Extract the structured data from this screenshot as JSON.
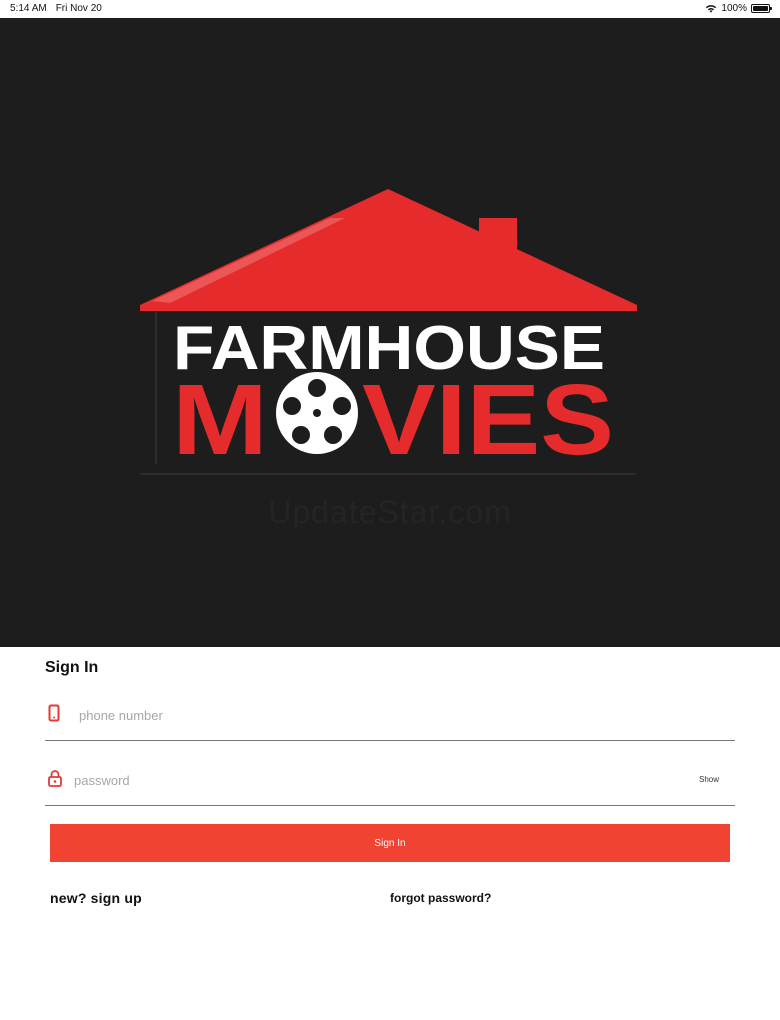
{
  "status_bar": {
    "time": "5:14 AM",
    "date": "Fri Nov 20",
    "battery": "100%",
    "icons": [
      "wifi-icon",
      "battery-icon"
    ]
  },
  "hero": {
    "logo": {
      "line1": "FARMHOUSE",
      "line2_prefix": "M",
      "line2_suffix": "VIES",
      "icons": [
        "house-roof-icon",
        "film-reel-icon"
      ]
    },
    "watermark": "UpdateStar.com"
  },
  "sign_in": {
    "title": "Sign In",
    "phone": {
      "placeholder": "phone number",
      "value": "",
      "icon": "phone-icon"
    },
    "password": {
      "placeholder": "password",
      "value": "",
      "icon": "lock-icon",
      "toggle_label": "Show"
    },
    "submit_label": "Sign In",
    "signup_link": "new? sign up",
    "forgot_link": "forgot password?"
  },
  "colors": {
    "accent": "#f04332",
    "logo_red": "#e52b2b",
    "hero_bg": "#1d1d1d"
  }
}
